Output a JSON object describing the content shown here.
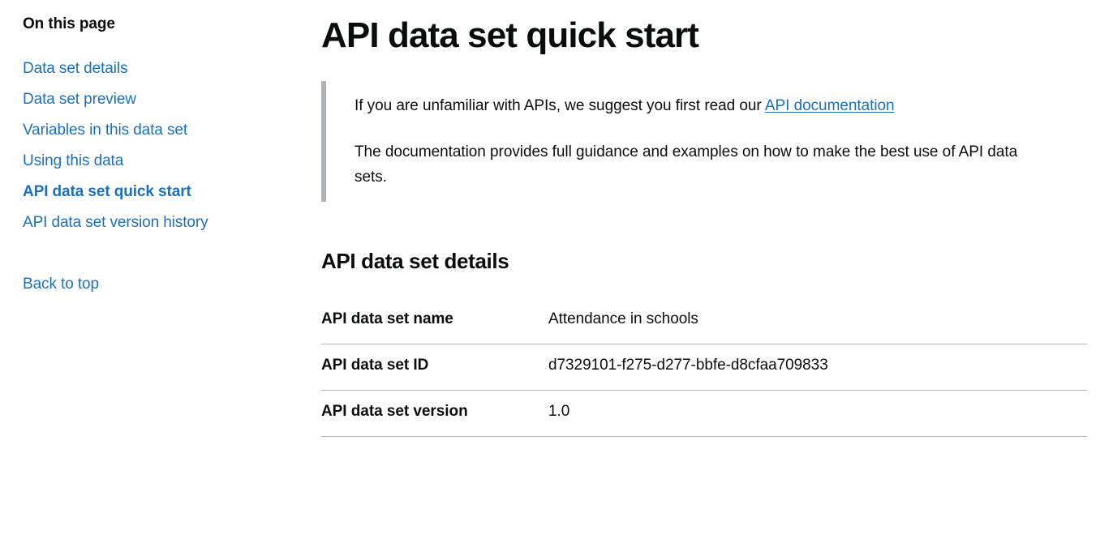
{
  "sidebar": {
    "heading": "On this page",
    "items": [
      {
        "label": "Data set details",
        "active": false,
        "spaced": false
      },
      {
        "label": "Data set preview",
        "active": false,
        "spaced": false
      },
      {
        "label": "Variables in this data set",
        "active": false,
        "spaced": false
      },
      {
        "label": "Using this data",
        "active": false,
        "spaced": false
      },
      {
        "label": "API data set quick start",
        "active": true,
        "spaced": false
      },
      {
        "label": "API data set version history",
        "active": false,
        "spaced": false
      },
      {
        "label": "Back to top",
        "active": false,
        "spaced": true
      }
    ]
  },
  "main": {
    "title": "API data set quick start",
    "inset": {
      "paragraph1_before_link": "If you are unfamiliar with APIs, we suggest you first read our ",
      "link_text": "API documentation",
      "paragraph2": "The documentation provides full guidance and examples on how to make the best use of API data sets."
    },
    "details_heading": "API data set details",
    "details_rows": [
      {
        "label": "API data set name",
        "value": "Attendance in schools"
      },
      {
        "label": "API data set ID",
        "value": "d7329101-f275-d277-bbfe-d8cfaa709833"
      },
      {
        "label": "API data set version",
        "value": "1.0"
      }
    ]
  },
  "colors": {
    "link": "#1d70b8",
    "text": "#0b0c0c",
    "rule": "#b1b4b6"
  }
}
